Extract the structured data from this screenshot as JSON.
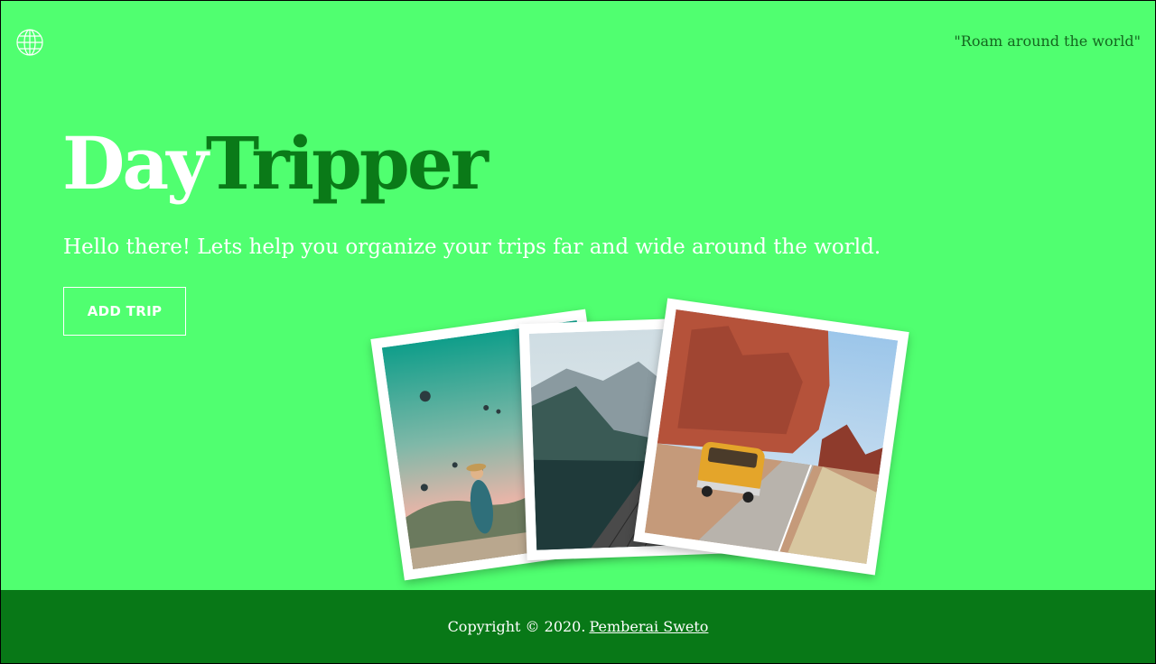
{
  "header": {
    "globe_icon": "globe-icon",
    "tagline": "\"Roam around the world\""
  },
  "hero": {
    "brand_part1": "Day",
    "brand_part2": "Tripper",
    "intro": "Hello there! Lets help you organize your trips far and wide around the world.",
    "add_trip_label": "ADD TRIP"
  },
  "photos": [
    {
      "name": "balloons-photo"
    },
    {
      "name": "mountain-lake-photo"
    },
    {
      "name": "desert-van-photo"
    }
  ],
  "footer": {
    "copyright": "Copyright © 2020.",
    "author": "Pemberai Sweto"
  },
  "colors": {
    "background": "#50ff70",
    "brand_dark": "#0a7a18",
    "footer": "#087817",
    "text_light": "#ffffff"
  }
}
